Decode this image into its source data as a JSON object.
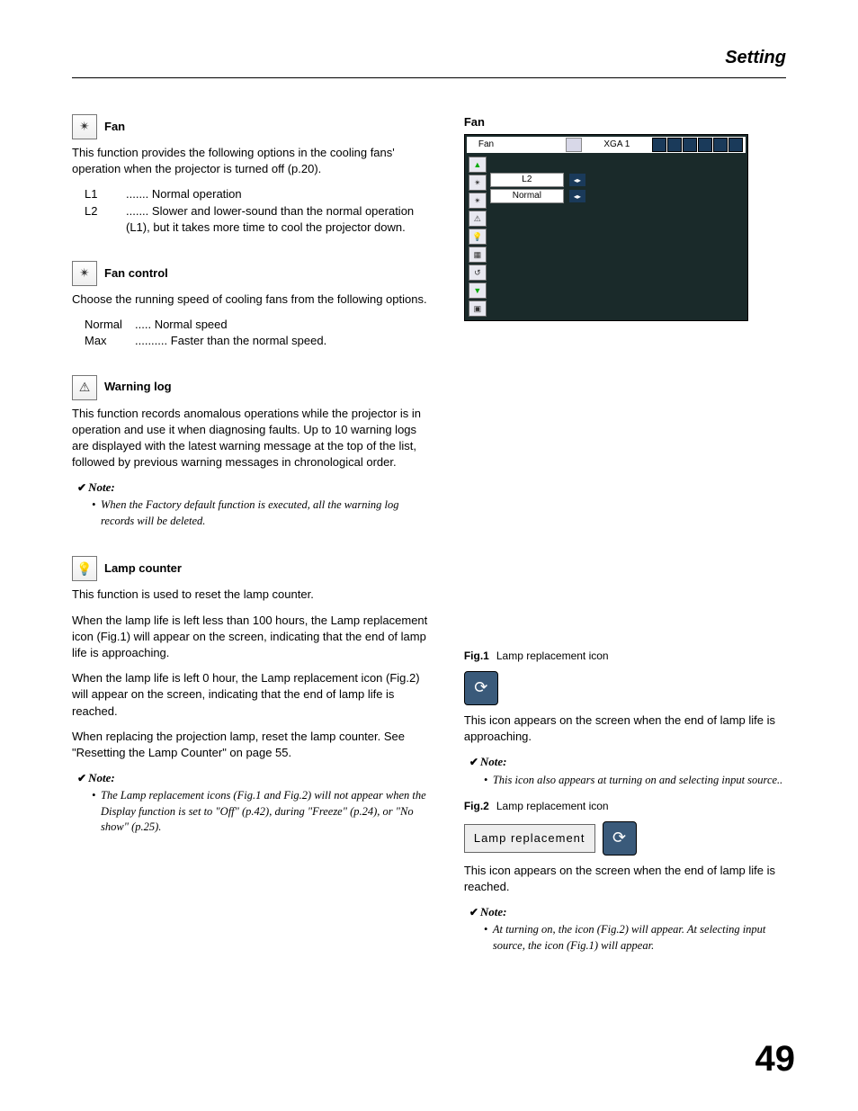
{
  "header": {
    "title": "Setting"
  },
  "left": {
    "fan": {
      "title": "Fan",
      "desc": "This function provides the following options in the cooling fans' operation when the projector is turned off (p.20).",
      "items": [
        {
          "key": "L1",
          "dots": ".......",
          "val": "Normal operation"
        },
        {
          "key": "L2",
          "dots": ".......",
          "val": "Slower and lower-sound than the normal operation (L1), but it takes more time to cool the projector down."
        }
      ]
    },
    "fanControl": {
      "title": "Fan control",
      "desc": "Choose the running speed of cooling fans from the following options.",
      "items": [
        {
          "key": "Normal",
          "dots": ".....",
          "val": "Normal speed"
        },
        {
          "key": "Max",
          "dots": "..........",
          "val": "Faster than the normal speed."
        }
      ]
    },
    "warningLog": {
      "title": "Warning log",
      "desc": "This function records anomalous operations while the projector is in operation and use it when diagnosing faults. Up to 10 warning logs are displayed with the latest warning message at the top of the list, followed by previous warning messages in chronological order.",
      "noteLabel": "Note:",
      "note": "When the Factory default function is executed, all the warning log records will be deleted."
    },
    "lampCounter": {
      "title": "Lamp counter",
      "p1": "This function is used to reset the lamp counter.",
      "p2": "When the lamp life is left less than 100 hours, the Lamp replacement icon (Fig.1) will appear on the screen, indicating that the end of lamp life is approaching.",
      "p3": "When the lamp life is left 0 hour, the Lamp replacement icon (Fig.2) will appear on the screen, indicating that the end of lamp life is reached.",
      "p4": "When replacing the projection lamp, reset the lamp counter. See \"Resetting the Lamp Counter\" on page 55.",
      "noteLabel": "Note:",
      "note": "The Lamp replacement icons (Fig.1 and Fig.2) will not appear when the Display function is set to \"Off\" (p.42), during \"Freeze\" (p.24), or \"No show\" (p.25)."
    }
  },
  "right": {
    "osdTitle": "Fan",
    "osd": {
      "topLabel": "Fan",
      "mode": "XGA 1",
      "row1": "L2",
      "row2": "Normal"
    },
    "fig1": {
      "label": "Fig.1",
      "caption": "Lamp replacement icon",
      "desc": "This icon appears on the screen when the end of lamp life is approaching.",
      "noteLabel": "Note:",
      "note": "This icon also appears at turning on and selecting input source.."
    },
    "fig2": {
      "label": "Fig.2",
      "caption": "Lamp replacement icon",
      "boxText": "Lamp replacement",
      "desc": "This icon appears on the screen when the end of lamp life is reached.",
      "noteLabel": "Note:",
      "note": "At turning on, the icon (Fig.2) will appear. At selecting input source, the icon (Fig.1) will appear."
    }
  },
  "pageNumber": "49"
}
